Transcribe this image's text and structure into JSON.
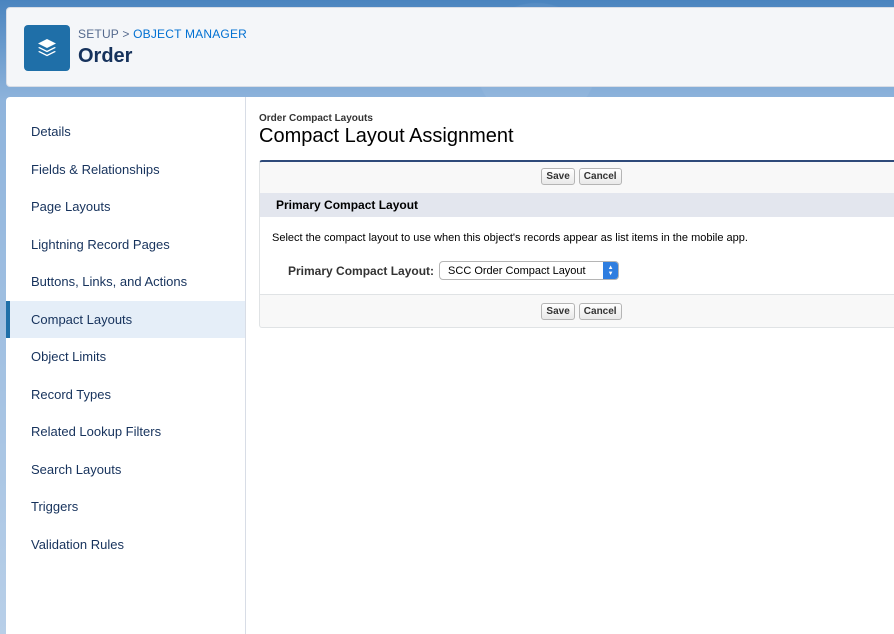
{
  "header": {
    "breadcrumb_setup": "SETUP",
    "breadcrumb_sep": ">",
    "breadcrumb_object_manager": "OBJECT MANAGER",
    "title": "Order",
    "icon": "layers-icon"
  },
  "sidebar": {
    "items": [
      {
        "label": "Details",
        "active": false
      },
      {
        "label": "Fields & Relationships",
        "active": false
      },
      {
        "label": "Page Layouts",
        "active": false
      },
      {
        "label": "Lightning Record Pages",
        "active": false
      },
      {
        "label": "Buttons, Links, and Actions",
        "active": false
      },
      {
        "label": "Compact Layouts",
        "active": true
      },
      {
        "label": "Object Limits",
        "active": false
      },
      {
        "label": "Record Types",
        "active": false
      },
      {
        "label": "Related Lookup Filters",
        "active": false
      },
      {
        "label": "Search Layouts",
        "active": false
      },
      {
        "label": "Triggers",
        "active": false
      },
      {
        "label": "Validation Rules",
        "active": false
      }
    ]
  },
  "content": {
    "crumb": "Order Compact Layouts",
    "title": "Compact Layout Assignment",
    "save_label": "Save",
    "cancel_label": "Cancel",
    "section_title": "Primary Compact Layout",
    "help_text": "Select the compact layout to use when this object's records appear as list items in the mobile app.",
    "field_label": "Primary Compact Layout:",
    "field_value": "SCC Order Compact Layout"
  },
  "colors": {
    "accent": "#1f6fa8",
    "link": "#0070d2",
    "active_bg": "#e5eef8",
    "select_arrow": "#2f7ee0"
  }
}
